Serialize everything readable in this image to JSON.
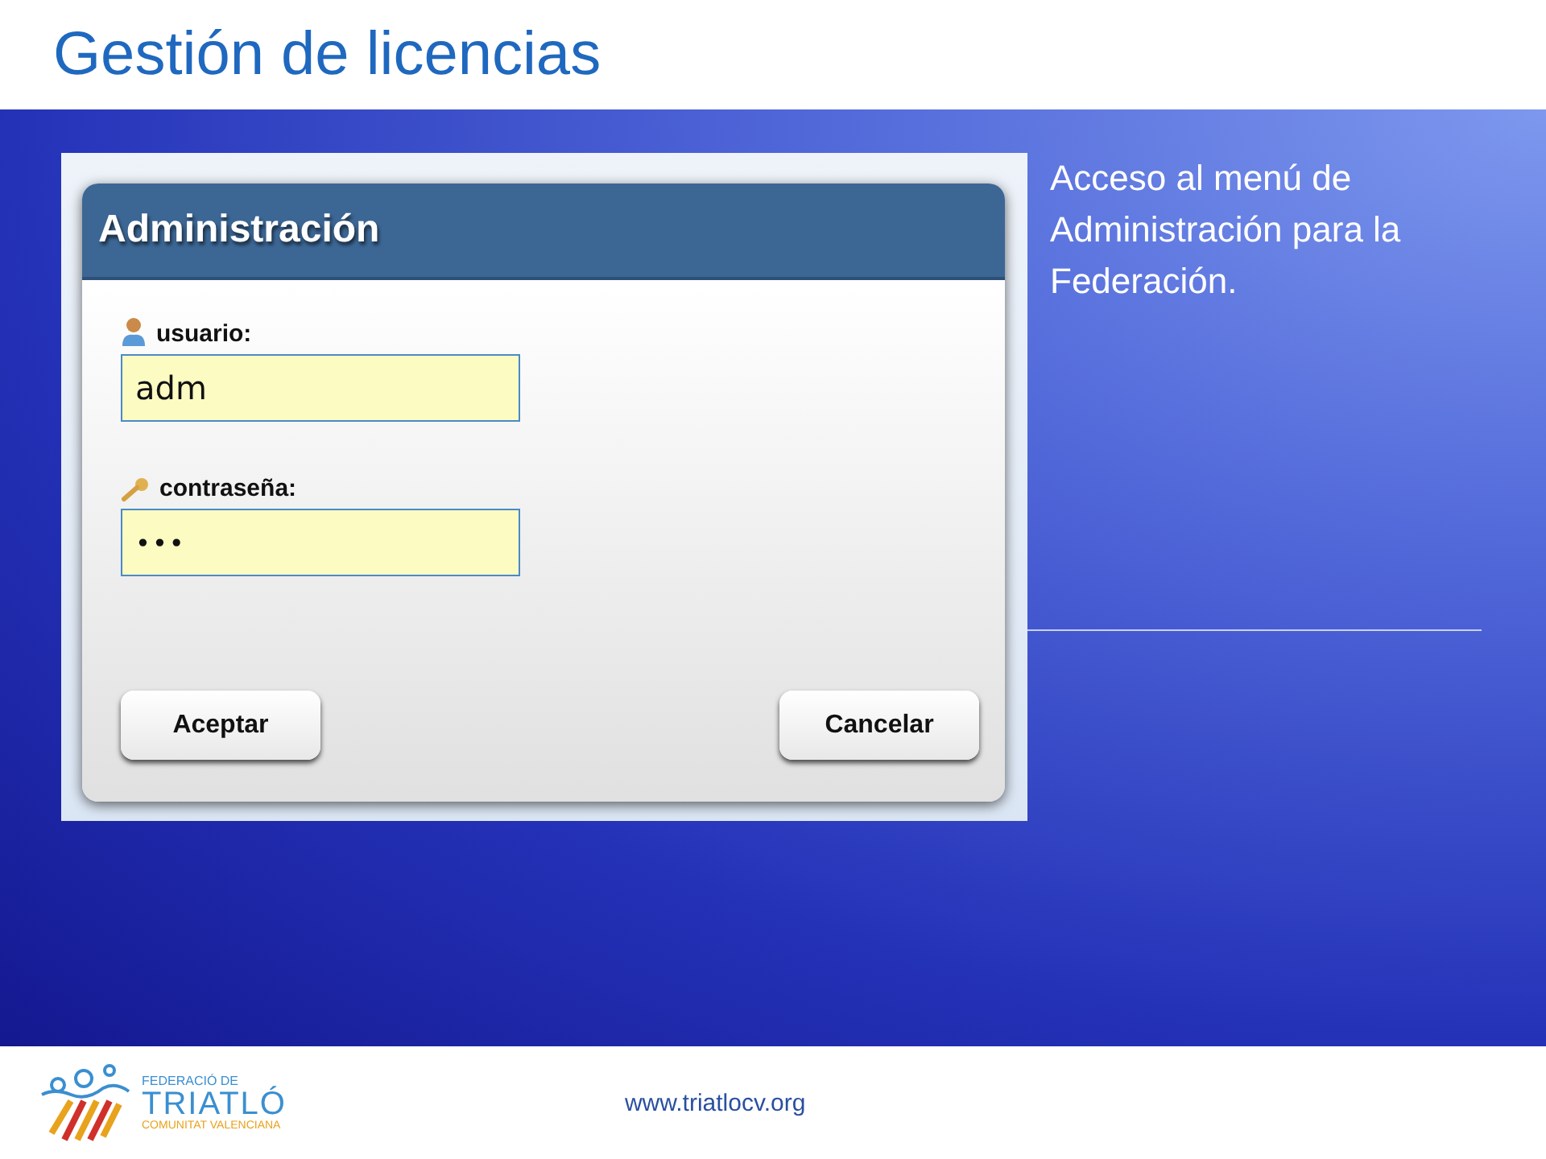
{
  "slide": {
    "title": "Gestión de licencias",
    "note": "Acceso al menú de Administración para la Federación.",
    "footer_url": "www.triatlocv.org",
    "logo": {
      "line_1": "FEDERACIÓ DE",
      "line_2": "TRIATLÓ",
      "line_3": "COMUNITAT VALENCIANA"
    }
  },
  "dialog": {
    "title": "Administración",
    "fields": [
      {
        "kind": "user",
        "label": "usuario:",
        "value": "adm"
      },
      {
        "kind": "key",
        "label": "contraseña:",
        "value": "•••"
      }
    ],
    "buttons": [
      "Aceptar",
      "Cancelar"
    ]
  }
}
